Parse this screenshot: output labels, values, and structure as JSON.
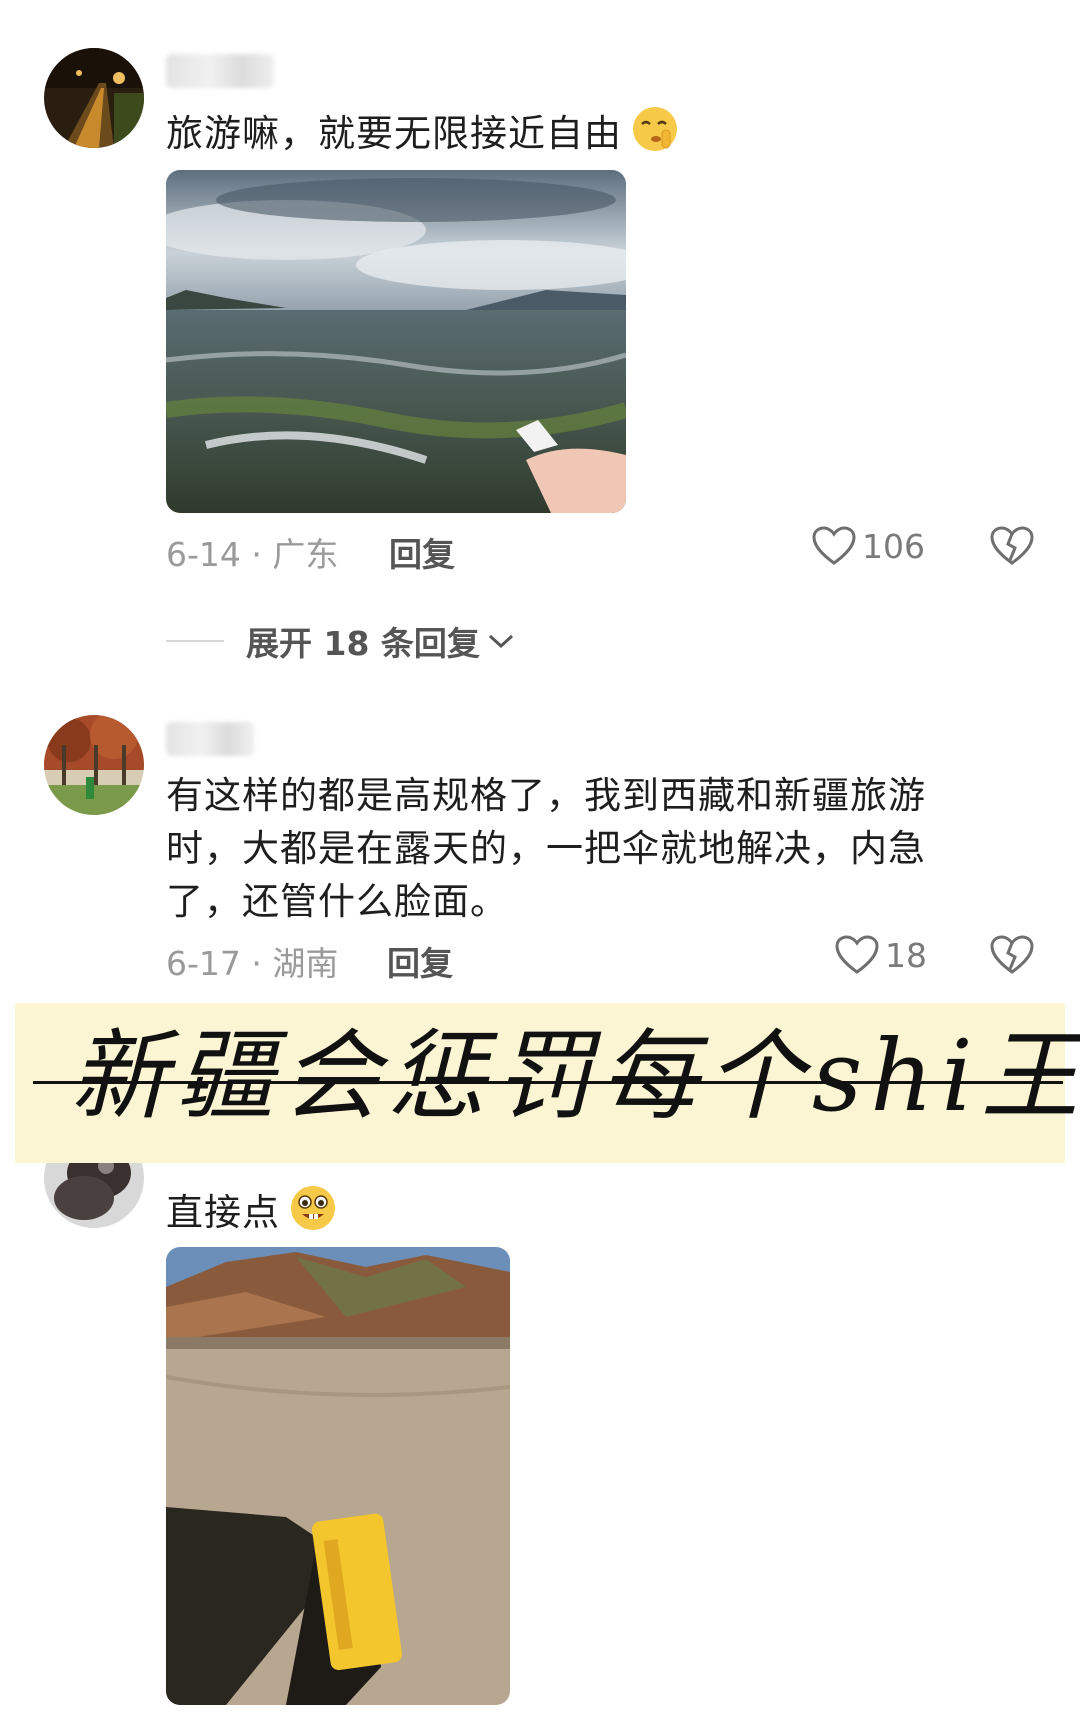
{
  "comments": [
    {
      "text": "旅游嘛，就要无限接近自由",
      "emoji": "shushing-face-emoji",
      "date_location": "6-14 · 广东",
      "reply_label": "回复",
      "likes": "106",
      "expand_label": "展开 18 条回复"
    },
    {
      "text_lines": [
        "有这样的都是高规格了，我到西藏和新疆旅游",
        "时，大都是在露天的，一把伞就地解决，内急",
        "了，还管什么脸面。"
      ],
      "date_location": "6-17 · 湖南",
      "reply_label": "回复",
      "likes": "18"
    },
    {
      "text": "直接点",
      "emoji": "grinning-teeth-face-emoji"
    }
  ],
  "overlay_caption": "新疆会惩罚每个shi王",
  "colors": {
    "banner_bg": "#fbf5d4",
    "meta_gray": "#9a9a9a",
    "text_dark": "#1e1e1e"
  }
}
